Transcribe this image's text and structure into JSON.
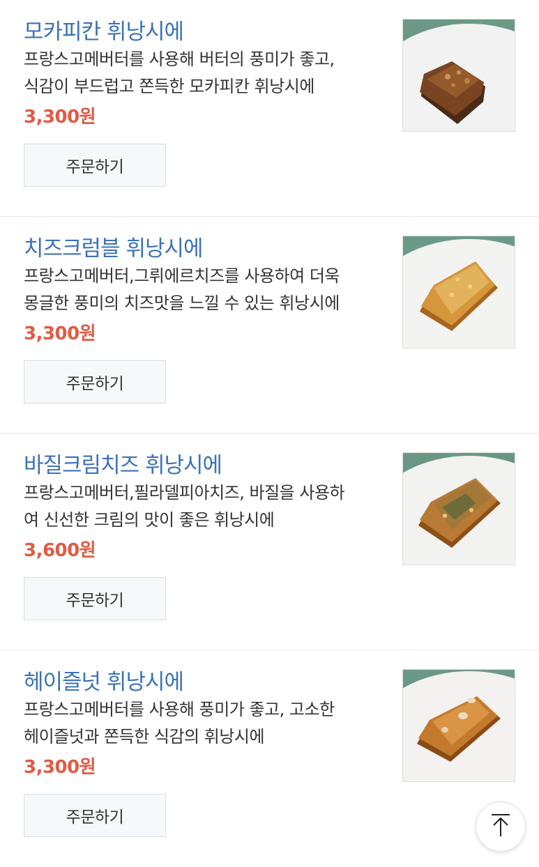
{
  "products": [
    {
      "name": "모카피칸 휘낭시에",
      "desc_lines": [
        "프랑스고메버터를 사용해 버터의 풍미가 좋고,",
        "식감이 부드럽고 쫀득한 모카피칸 휘낭시에"
      ],
      "price": "3,300원",
      "order_label": "주문하기"
    },
    {
      "name": "치즈크럼블 휘낭시에",
      "desc_lines": [
        "프랑스고메버터,그뤼에르치즈를 사용하여 더욱",
        "몽글한 풍미의 치즈맛을 느낄 수 있는 휘낭시에"
      ],
      "price": "3,300원",
      "order_label": "주문하기"
    },
    {
      "name": "바질크림치즈 휘낭시에",
      "desc_lines": [
        "프랑스고메버터,필라델피아치즈, 바질을 사용하",
        "여 신선한 크림의 맛이 좋은 휘낭시에"
      ],
      "price": "3,600원",
      "order_label": "주문하기"
    },
    {
      "name": "헤이즐넛 휘낭시에",
      "desc_lines": [
        "프랑스고메버터를 사용해 풍미가 좋고, 고소한",
        "헤이즐넛과 쫀득한 식감의 휘낭시에"
      ],
      "price": "3,300원",
      "order_label": "주문하기"
    }
  ],
  "colors": {
    "title": "#3b72b7",
    "price": "#e05b45",
    "text": "#333333"
  },
  "icons": {
    "scroll_top": "arrow-up-to-line-icon"
  }
}
